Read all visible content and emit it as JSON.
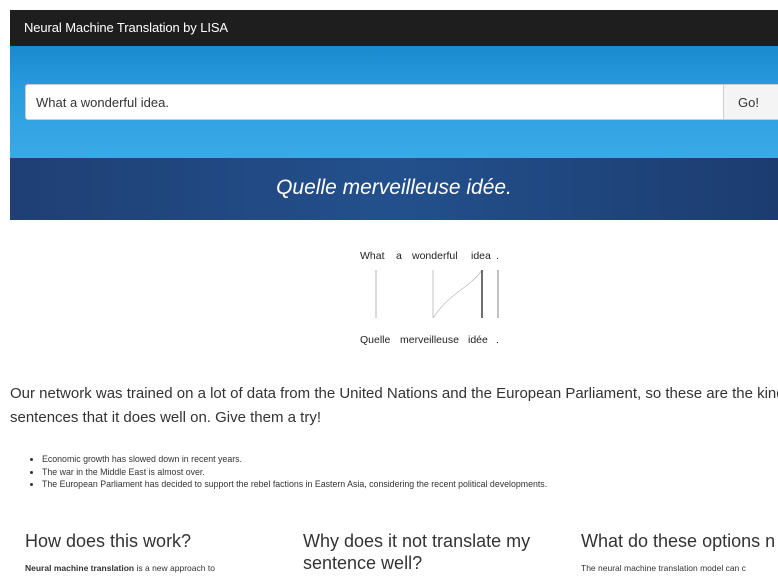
{
  "navbar": {
    "brand": "Neural Machine Translation by LISA"
  },
  "search": {
    "value": "What a wonderful idea.",
    "go_label": "Go!"
  },
  "result": {
    "translation": "Quelle merveilleuse idée."
  },
  "alignment": {
    "source_tokens": [
      "What",
      "a",
      "wonderful",
      "idea",
      "."
    ],
    "target_tokens": [
      "Quelle",
      "merveilleuse",
      "idée",
      "."
    ]
  },
  "intro": {
    "line1": "Our network was trained on a lot of data from the United Nations and the European Parliament, so these are the kind",
    "line2": "sentences that it does well on. Give them a try!"
  },
  "examples": [
    "Economic growth has slowed down in recent years.",
    "The war in the Middle East is almost over.",
    "The European Parliament has decided to support the rebel factions in Eastern Asia, considering the recent political developments."
  ],
  "columns": {
    "how": {
      "title": "How does this work?",
      "body_bold": "Neural machine translation",
      "body_rest": " is a new approach to"
    },
    "why": {
      "title_line1": "Why does it not translate my",
      "title_line2": "sentence well?"
    },
    "options": {
      "title": "What do these options n",
      "body": "The neural machine translation model can c"
    }
  }
}
